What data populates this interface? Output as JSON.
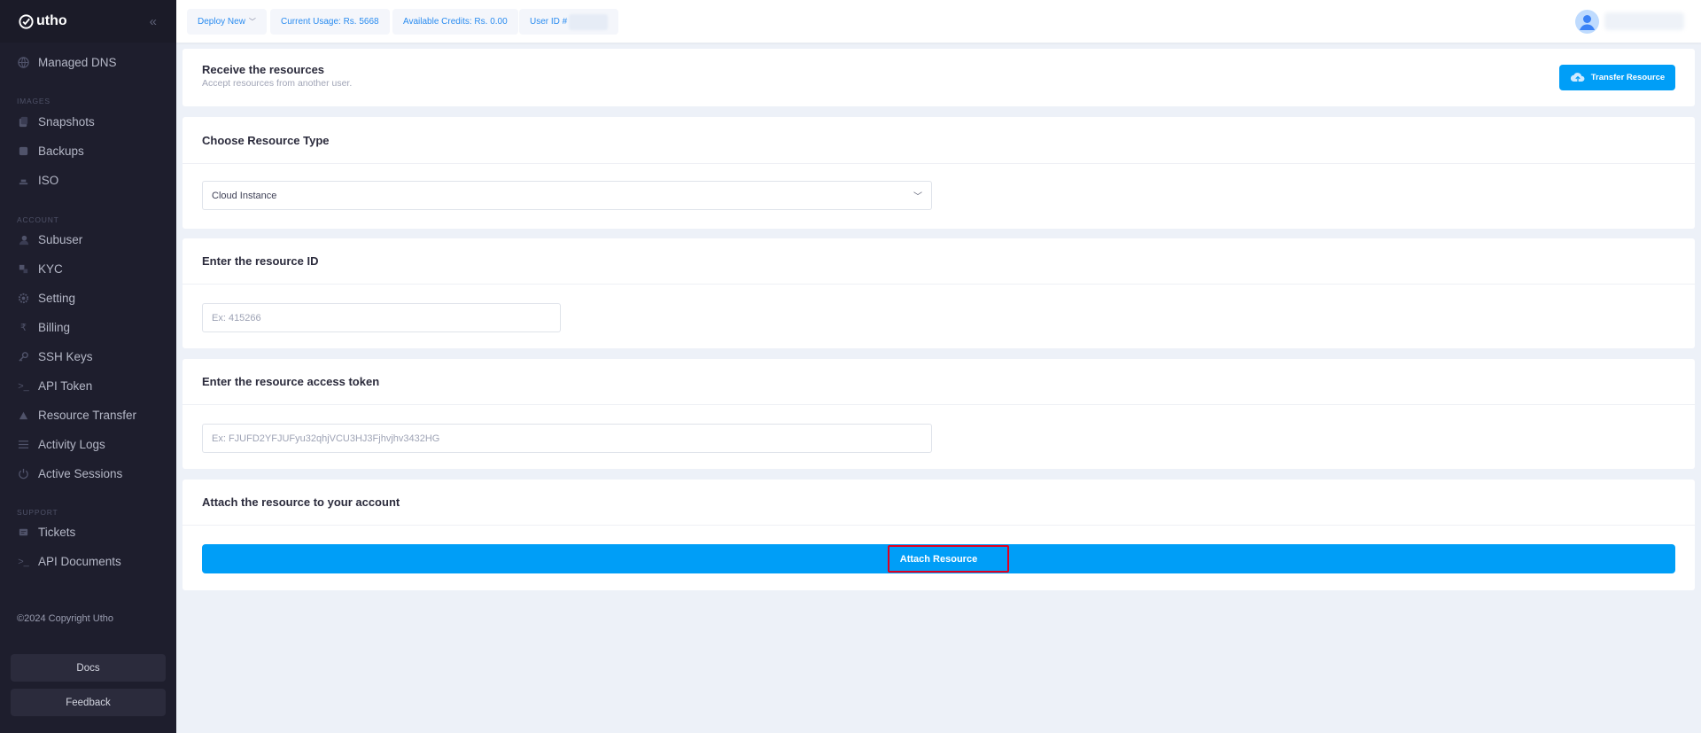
{
  "brand": {
    "name": "utho"
  },
  "sidebar": {
    "items_top": [
      {
        "label": "Managed DNS",
        "icon": "globe-icon"
      }
    ],
    "sections": [
      {
        "label": "IMAGES",
        "items": [
          {
            "label": "Snapshots",
            "icon": "snapshot-icon"
          },
          {
            "label": "Backups",
            "icon": "backup-icon"
          },
          {
            "label": "ISO",
            "icon": "iso-icon"
          }
        ]
      },
      {
        "label": "ACCOUNT",
        "items": [
          {
            "label": "Subuser",
            "icon": "subuser-icon"
          },
          {
            "label": "KYC",
            "icon": "kyc-icon"
          },
          {
            "label": "Setting",
            "icon": "gear-icon"
          },
          {
            "label": "Billing",
            "icon": "rupee-icon"
          },
          {
            "label": "SSH Keys",
            "icon": "key-icon"
          },
          {
            "label": "API Token",
            "icon": "terminal-icon"
          },
          {
            "label": "Resource Transfer",
            "icon": "transfer-icon"
          },
          {
            "label": "Activity Logs",
            "icon": "sliders-icon"
          },
          {
            "label": "Active Sessions",
            "icon": "power-icon"
          }
        ]
      },
      {
        "label": "SUPPORT",
        "items": [
          {
            "label": "Tickets",
            "icon": "ticket-icon"
          },
          {
            "label": "API Documents",
            "icon": "terminal-icon"
          }
        ]
      }
    ],
    "copyright": "©2024 Copyright Utho",
    "docs_label": "Docs",
    "feedback_label": "Feedback"
  },
  "topbar": {
    "deploy_label": "Deploy New",
    "usage_label": "Current Usage: Rs. 5668",
    "credits_label": "Available Credits: Rs. 0.00",
    "userid_label": "User ID #"
  },
  "receive": {
    "title": "Receive the resources",
    "subtitle": "Accept resources from another user.",
    "transfer_button": "Transfer Resource"
  },
  "resource_type": {
    "title": "Choose Resource Type",
    "selected": "Cloud Instance"
  },
  "resource_id": {
    "title": "Enter the resource ID",
    "placeholder": "Ex: 415266"
  },
  "access_token": {
    "title": "Enter the resource access token",
    "placeholder": "Ex: FJUFD2YFJUFyu32qhjVCU3HJ3Fjhvjhv3432HG"
  },
  "attach": {
    "title": "Attach the resource to your account",
    "button": "Attach Resource"
  },
  "colors": {
    "accent": "#009ef7",
    "sidebar_bg": "#1e1e2d",
    "highlight": "#e00020"
  }
}
